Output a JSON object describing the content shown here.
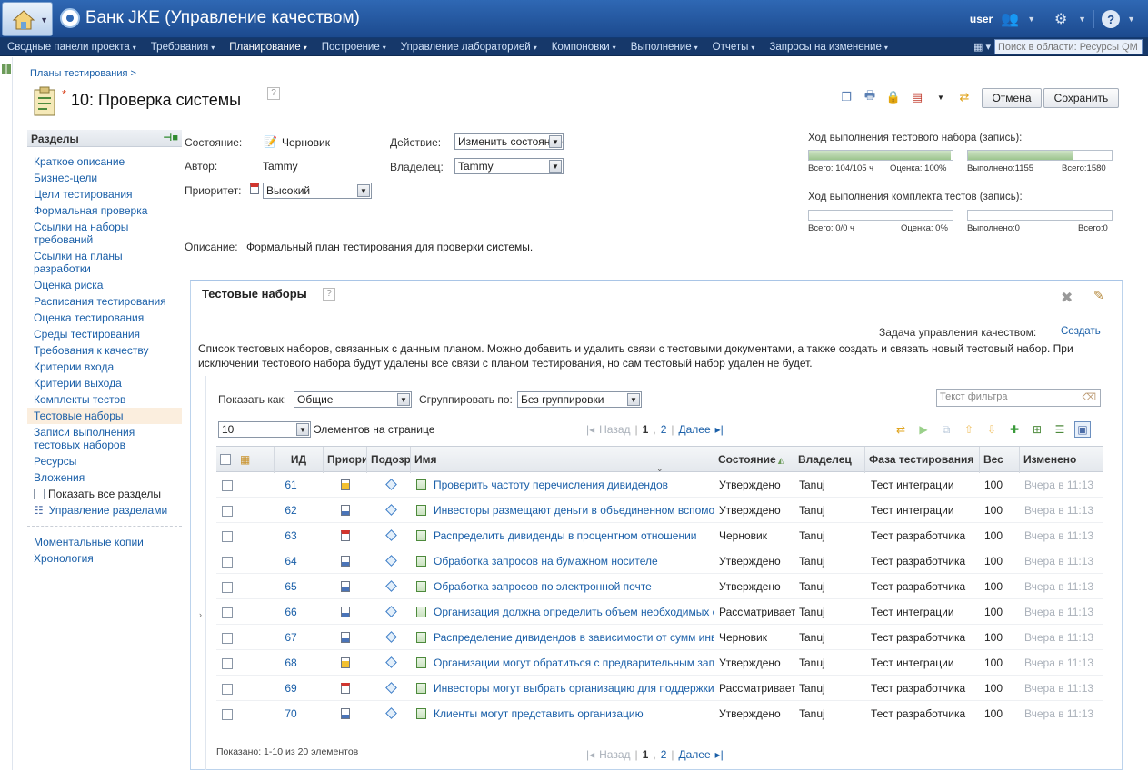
{
  "app": {
    "title": "Банк JKE (Управление качеством)",
    "user": "user"
  },
  "nav": {
    "items": [
      {
        "label": "Сводные панели проекта",
        "active": false
      },
      {
        "label": "Требования",
        "active": false
      },
      {
        "label": "Планирование",
        "active": true
      },
      {
        "label": "Построение",
        "active": false
      },
      {
        "label": "Управление лабораторией",
        "active": false
      },
      {
        "label": "Компоновки",
        "active": false
      },
      {
        "label": "Выполнение",
        "active": false
      },
      {
        "label": "Отчеты",
        "active": false
      },
      {
        "label": "Запросы на изменение",
        "active": false
      }
    ],
    "search_placeholder": "Поиск в области: Ресурсы QM"
  },
  "breadcrumb": "Планы тестирования >",
  "plan": {
    "number": "10:",
    "name": "Проверка системы",
    "cancel_label": "Отмена",
    "save_label": "Сохранить"
  },
  "sections": {
    "title": "Разделы",
    "items": [
      "Краткое описание",
      "Бизнес-цели",
      "Цели тестирования",
      "Формальная проверка",
      "Ссылки на наборы требований",
      "Ссылки на планы разработки",
      "Оценка риска",
      "Расписания тестирования",
      "Оценка тестирования",
      "Среды тестирования",
      "Требования к качеству",
      "Критерии входа",
      "Критерии выхода",
      "Комплекты тестов",
      "Тестовые наборы",
      "Записи выполнения тестовых наборов",
      "Ресурсы",
      "Вложения"
    ],
    "active_index": 14,
    "show_all_label": "Показать все разделы",
    "manage_label": "Управление разделами",
    "extra": [
      "Моментальные копии",
      "Хронология"
    ]
  },
  "form": {
    "state_label": "Состояние:",
    "state_value": "Черновик",
    "author_label": "Автор:",
    "author_value": "Tammy",
    "priority_label": "Приоритет:",
    "priority_value": "Высокий",
    "action_label": "Действие:",
    "action_value": "Изменить состояние",
    "owner_label": "Владелец:",
    "owner_value": "Tammy",
    "desc_label": "Описание:",
    "desc_value": "Формальный план тестирования для проверки системы."
  },
  "progress": {
    "suite_title": "Ход выполнения тестового набора (запись):",
    "suite_total_label": "Всего: 104/105 ч",
    "suite_score_label": "Оценка: 100%",
    "suite_done_label": "Выполнено:1155",
    "suite_all_label": "Всего:1580",
    "suite_bar1_fraction": 0.99,
    "suite_bar2_fraction": 0.73,
    "kit_title": "Ход выполнения комплекта тестов (запись):",
    "kit_total_label": "Всего: 0/0 ч",
    "kit_score_label": "Оценка: 0%",
    "kit_done_label": "Выполнено:0",
    "kit_all_label": "Всего:0",
    "kit_bar1_fraction": 0,
    "kit_bar2_fraction": 0
  },
  "suites": {
    "title": "Тестовые наборы",
    "qm_task_label": "Задача управления качеством:",
    "create_label": "Создать",
    "description": "Список тестовых наборов, связанных с данным планом. Можно добавить и удалить связи с тестовыми документами, а также создать и связать новый тестовый набор. При исключении тестового набора будут удалены все связи с планом тестирования, но сам тестовый набор удален не будет.",
    "show_as_label": "Показать как:",
    "show_as_value": "Общие",
    "group_label": "Сгруппировать по:",
    "group_value": "Без группировки",
    "filter_placeholder": "Текст фильтра",
    "per_page_value": "10",
    "per_page_label": "Элементов на странице",
    "pager": {
      "back": "Назад",
      "page1": "1",
      "page2": "2",
      "next": "Далее"
    },
    "columns": {
      "id": "ИД",
      "priority": "Приоритет",
      "suspect": "Подозрительный",
      "name": "Имя",
      "state": "Состояние",
      "owner": "Владелец",
      "phase": "Фаза тестирования",
      "weight": "Вес",
      "modified": "Изменено"
    },
    "rows": [
      {
        "id": "61",
        "priority": "medium",
        "name": "Проверить частоту перечисления дивидендов",
        "state": "Утверждено",
        "owner": "Tanuj",
        "phase": "Тест интеграции",
        "weight": "100",
        "modified": "Вчера в 11:13"
      },
      {
        "id": "62",
        "priority": "low",
        "name": "Инвесторы размещают деньги в объединенном вспомогательном фонде",
        "state": "Утверждено",
        "owner": "Tanuj",
        "phase": "Тест интеграции",
        "weight": "100",
        "modified": "Вчера в 11:13"
      },
      {
        "id": "63",
        "priority": "high",
        "name": "Распределить дивиденды в процентном отношении",
        "state": "Черновик",
        "owner": "Tanuj",
        "phase": "Тест разработчика",
        "weight": "100",
        "modified": "Вчера в 11:13"
      },
      {
        "id": "64",
        "priority": "low",
        "name": "Обработка запросов на бумажном носителе",
        "state": "Утверждено",
        "owner": "Tanuj",
        "phase": "Тест разработчика",
        "weight": "100",
        "modified": "Вчера в 11:13"
      },
      {
        "id": "65",
        "priority": "low",
        "name": "Обработка запросов по электронной почте",
        "state": "Утверждено",
        "owner": "Tanuj",
        "phase": "Тест разработчика",
        "weight": "100",
        "modified": "Вчера в 11:13"
      },
      {
        "id": "66",
        "priority": "low",
        "name": "Организация должна определить объем необходимых средств",
        "state": "Рассматривается",
        "owner": "Tanuj",
        "phase": "Тест интеграции",
        "weight": "100",
        "modified": "Вчера в 11:13"
      },
      {
        "id": "67",
        "priority": "low",
        "name": "Распределение дивидендов в зависимости от сумм инвестиций",
        "state": "Черновик",
        "owner": "Tanuj",
        "phase": "Тест разработчика",
        "weight": "100",
        "modified": "Вчера в 11:13"
      },
      {
        "id": "68",
        "priority": "medium",
        "name": "Организации могут обратиться с предварительным запросом",
        "state": "Утверждено",
        "owner": "Tanuj",
        "phase": "Тест интеграции",
        "weight": "100",
        "modified": "Вчера в 11:13"
      },
      {
        "id": "69",
        "priority": "high",
        "name": "Инвесторы могут выбрать организацию для поддержки",
        "state": "Рассматривается",
        "owner": "Tanuj",
        "phase": "Тест разработчика",
        "weight": "100",
        "modified": "Вчера в 11:13"
      },
      {
        "id": "70",
        "priority": "low",
        "name": "Клиенты могут представить организацию",
        "state": "Утверждено",
        "owner": "Tanuj",
        "phase": "Тест разработчика",
        "weight": "100",
        "modified": "Вчера в 11:13"
      }
    ],
    "shown_label": "Показано: 1-10 из 20 элементов"
  },
  "colors": {
    "title_bar": "#2f68b4",
    "nav_bar": "#16386a",
    "link": "#1a5fa8",
    "active_section": "#fbeede",
    "progress_fill": "#9cc48e"
  }
}
